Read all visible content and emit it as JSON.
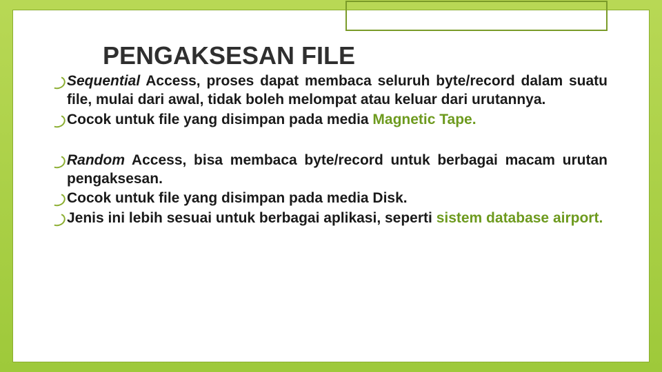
{
  "title": "PENGAKSESAN FILE",
  "block1": {
    "lead_italic": "Sequential",
    "lead_bold": " Access,",
    "rest": " proses dapat membaca seluruh byte/record dalam suatu file, mulai dari awal, tidak boleh melompat atau keluar dari urutannya.",
    "line2_pre": "Cocok untuk file yang disimpan pada media ",
    "line2_green": "Magnetic Tape."
  },
  "block2": {
    "lead_italic": "Random",
    "lead_bold": " Access,",
    "rest": " bisa membaca byte/record untuk berbagai macam urutan pengaksesan.",
    "line2": "Cocok untuk file yang disimpan pada media Disk.",
    "line3_pre": "Jenis ini lebih sesuai untuk berbagai aplikasi, seperti ",
    "line3_green": "sistem database airport."
  }
}
